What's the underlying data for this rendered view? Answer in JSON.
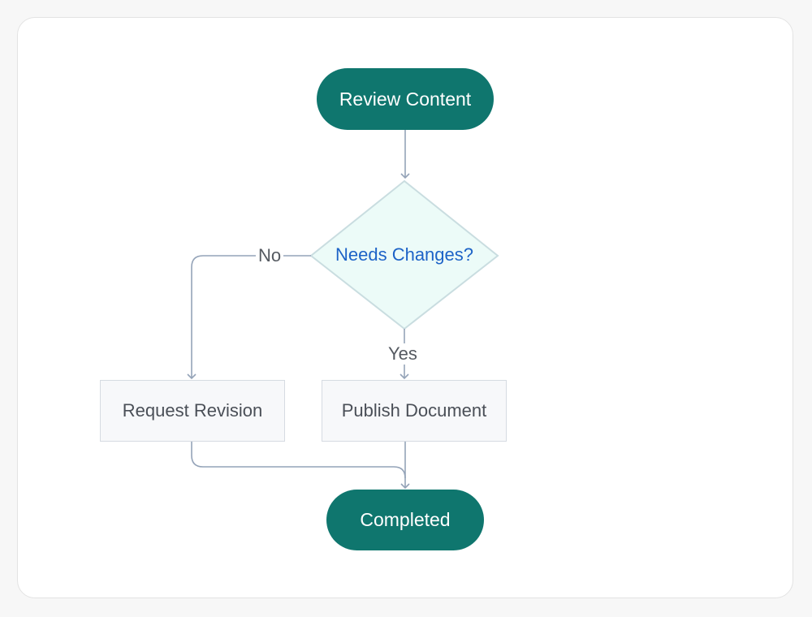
{
  "flowchart": {
    "nodes": {
      "start": {
        "label": "Review Content",
        "shape": "terminal"
      },
      "decision": {
        "label": "Needs Changes?",
        "shape": "diamond"
      },
      "revision": {
        "label": "Request Revision",
        "shape": "process"
      },
      "publish": {
        "label": "Publish Document",
        "shape": "process"
      },
      "end": {
        "label": "Completed",
        "shape": "terminal"
      }
    },
    "edges": {
      "no_label": "No",
      "yes_label": "Yes"
    },
    "colors": {
      "terminal_fill": "#0f766e",
      "terminal_text": "#ffffff",
      "decision_fill": "#ecfbf8",
      "decision_stroke": "#c9dde0",
      "decision_text": "#1d63c7",
      "process_fill": "#f7f8fa",
      "process_stroke": "#d6dbe2",
      "connector": "#94a3b8"
    }
  }
}
